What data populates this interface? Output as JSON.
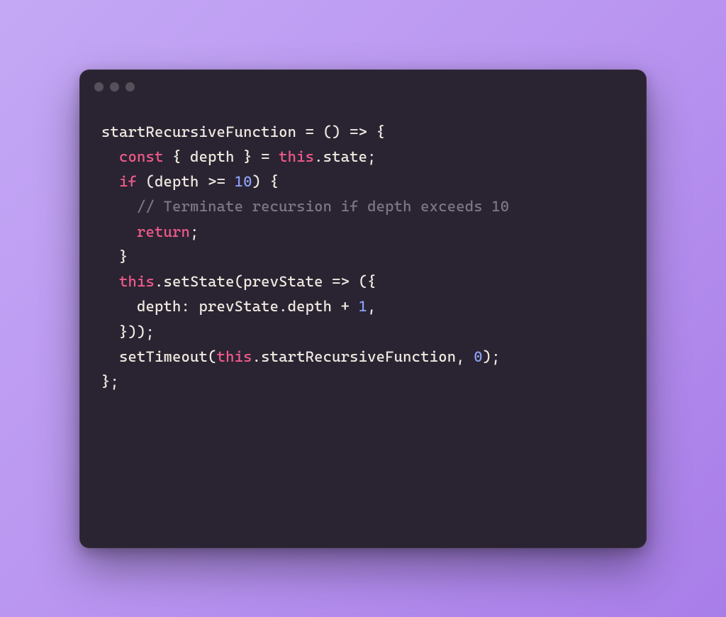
{
  "theme": {
    "bg_gradient_start": "#c4a8f5",
    "bg_gradient_end": "#a87de8",
    "window_bg": "#2a2432",
    "dot_color": "#55505a",
    "text_default": "#efe9e1",
    "text_keyword": "#f15a8a",
    "text_number": "#8b9ff5",
    "text_comment": "#7d7683"
  },
  "code": {
    "lines": [
      [
        {
          "t": "startRecursiveFunction = () ",
          "c": "id"
        },
        {
          "t": "=>",
          "c": "op"
        },
        {
          "t": " {",
          "c": "id"
        }
      ],
      [
        {
          "t": "  ",
          "c": "id"
        },
        {
          "t": "const",
          "c": "kw"
        },
        {
          "t": " { depth } = ",
          "c": "id"
        },
        {
          "t": "this",
          "c": "this"
        },
        {
          "t": ".state;",
          "c": "id"
        }
      ],
      [
        {
          "t": "  ",
          "c": "id"
        },
        {
          "t": "if",
          "c": "kw"
        },
        {
          "t": " (depth >= ",
          "c": "id"
        },
        {
          "t": "10",
          "c": "num"
        },
        {
          "t": ") {",
          "c": "id"
        }
      ],
      [
        {
          "t": "    ",
          "c": "id"
        },
        {
          "t": "// Terminate recursion if depth exceeds 10",
          "c": "com"
        }
      ],
      [
        {
          "t": "    ",
          "c": "id"
        },
        {
          "t": "return",
          "c": "kw"
        },
        {
          "t": ";",
          "c": "id"
        }
      ],
      [
        {
          "t": "  }",
          "c": "id"
        }
      ],
      [
        {
          "t": "  ",
          "c": "id"
        },
        {
          "t": "this",
          "c": "this"
        },
        {
          "t": ".setState(prevState ",
          "c": "id"
        },
        {
          "t": "=>",
          "c": "op"
        },
        {
          "t": " ({",
          "c": "id"
        }
      ],
      [
        {
          "t": "    depth: prevState.depth + ",
          "c": "id"
        },
        {
          "t": "1",
          "c": "num"
        },
        {
          "t": ",",
          "c": "id"
        }
      ],
      [
        {
          "t": "  }));",
          "c": "id"
        }
      ],
      [
        {
          "t": "  setTimeout(",
          "c": "id"
        },
        {
          "t": "this",
          "c": "this"
        },
        {
          "t": ".startRecursiveFunction, ",
          "c": "id"
        },
        {
          "t": "0",
          "c": "num"
        },
        {
          "t": ");",
          "c": "id"
        }
      ],
      [
        {
          "t": "};",
          "c": "id"
        }
      ]
    ]
  }
}
